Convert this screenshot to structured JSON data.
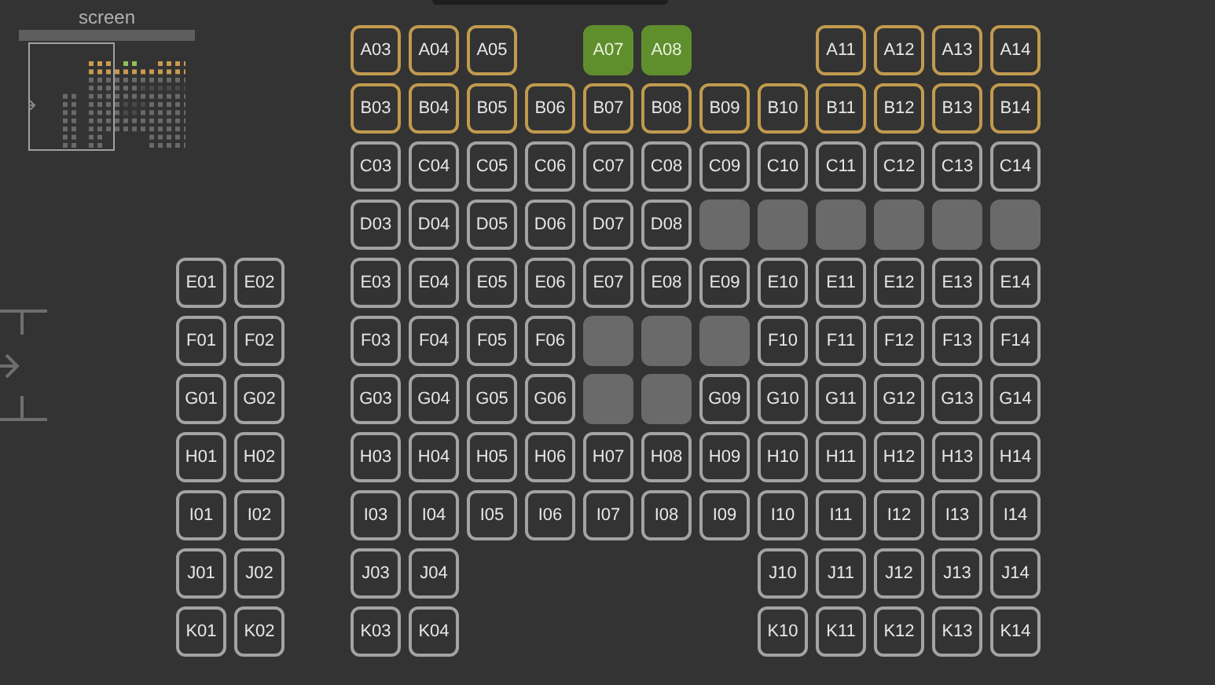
{
  "minimap": {
    "title": "screen"
  },
  "rows": [
    {
      "seats": [
        {
          "kind": "none"
        },
        {
          "kind": "none"
        },
        {
          "kind": "premium",
          "label": "A03"
        },
        {
          "kind": "premium",
          "label": "A04"
        },
        {
          "kind": "premium",
          "label": "A05"
        },
        {
          "kind": "none"
        },
        {
          "kind": "selected",
          "label": "A07"
        },
        {
          "kind": "selected",
          "label": "A08"
        },
        {
          "kind": "none"
        },
        {
          "kind": "none"
        },
        {
          "kind": "premium",
          "label": "A11"
        },
        {
          "kind": "premium",
          "label": "A12"
        },
        {
          "kind": "premium",
          "label": "A13"
        },
        {
          "kind": "premium",
          "label": "A14"
        }
      ]
    },
    {
      "seats": [
        {
          "kind": "none"
        },
        {
          "kind": "none"
        },
        {
          "kind": "premium",
          "label": "B03"
        },
        {
          "kind": "premium",
          "label": "B04"
        },
        {
          "kind": "premium",
          "label": "B05"
        },
        {
          "kind": "premium",
          "label": "B06"
        },
        {
          "kind": "premium",
          "label": "B07"
        },
        {
          "kind": "premium",
          "label": "B08"
        },
        {
          "kind": "premium",
          "label": "B09"
        },
        {
          "kind": "premium",
          "label": "B10"
        },
        {
          "kind": "premium",
          "label": "B11"
        },
        {
          "kind": "premium",
          "label": "B12"
        },
        {
          "kind": "premium",
          "label": "B13"
        },
        {
          "kind": "premium",
          "label": "B14"
        }
      ]
    },
    {
      "seats": [
        {
          "kind": "none"
        },
        {
          "kind": "none"
        },
        {
          "kind": "standard",
          "label": "C03"
        },
        {
          "kind": "standard",
          "label": "C04"
        },
        {
          "kind": "standard",
          "label": "C05"
        },
        {
          "kind": "standard",
          "label": "C06"
        },
        {
          "kind": "standard",
          "label": "C07"
        },
        {
          "kind": "standard",
          "label": "C08"
        },
        {
          "kind": "standard",
          "label": "C09"
        },
        {
          "kind": "standard",
          "label": "C10"
        },
        {
          "kind": "standard",
          "label": "C11"
        },
        {
          "kind": "standard",
          "label": "C12"
        },
        {
          "kind": "standard",
          "label": "C13"
        },
        {
          "kind": "standard",
          "label": "C14"
        }
      ]
    },
    {
      "seats": [
        {
          "kind": "none"
        },
        {
          "kind": "none"
        },
        {
          "kind": "standard",
          "label": "D03"
        },
        {
          "kind": "standard",
          "label": "D04"
        },
        {
          "kind": "standard",
          "label": "D05"
        },
        {
          "kind": "standard",
          "label": "D06"
        },
        {
          "kind": "standard",
          "label": "D07"
        },
        {
          "kind": "standard",
          "label": "D08"
        },
        {
          "kind": "taken"
        },
        {
          "kind": "taken"
        },
        {
          "kind": "taken"
        },
        {
          "kind": "taken"
        },
        {
          "kind": "taken"
        },
        {
          "kind": "taken"
        }
      ]
    },
    {
      "seats": [
        {
          "kind": "standard",
          "label": "E01"
        },
        {
          "kind": "standard",
          "label": "E02"
        },
        {
          "kind": "standard",
          "label": "E03"
        },
        {
          "kind": "standard",
          "label": "E04"
        },
        {
          "kind": "standard",
          "label": "E05"
        },
        {
          "kind": "standard",
          "label": "E06"
        },
        {
          "kind": "standard",
          "label": "E07"
        },
        {
          "kind": "standard",
          "label": "E08"
        },
        {
          "kind": "standard",
          "label": "E09"
        },
        {
          "kind": "standard",
          "label": "E10"
        },
        {
          "kind": "standard",
          "label": "E11"
        },
        {
          "kind": "standard",
          "label": "E12"
        },
        {
          "kind": "standard",
          "label": "E13"
        },
        {
          "kind": "standard",
          "label": "E14"
        }
      ]
    },
    {
      "seats": [
        {
          "kind": "standard",
          "label": "F01"
        },
        {
          "kind": "standard",
          "label": "F02"
        },
        {
          "kind": "standard",
          "label": "F03"
        },
        {
          "kind": "standard",
          "label": "F04"
        },
        {
          "kind": "standard",
          "label": "F05"
        },
        {
          "kind": "standard",
          "label": "F06"
        },
        {
          "kind": "taken"
        },
        {
          "kind": "taken"
        },
        {
          "kind": "taken"
        },
        {
          "kind": "standard",
          "label": "F10"
        },
        {
          "kind": "standard",
          "label": "F11"
        },
        {
          "kind": "standard",
          "label": "F12"
        },
        {
          "kind": "standard",
          "label": "F13"
        },
        {
          "kind": "standard",
          "label": "F14"
        }
      ]
    },
    {
      "seats": [
        {
          "kind": "standard",
          "label": "G01"
        },
        {
          "kind": "standard",
          "label": "G02"
        },
        {
          "kind": "standard",
          "label": "G03"
        },
        {
          "kind": "standard",
          "label": "G04"
        },
        {
          "kind": "standard",
          "label": "G05"
        },
        {
          "kind": "standard",
          "label": "G06"
        },
        {
          "kind": "taken"
        },
        {
          "kind": "taken"
        },
        {
          "kind": "standard",
          "label": "G09"
        },
        {
          "kind": "standard",
          "label": "G10"
        },
        {
          "kind": "standard",
          "label": "G11"
        },
        {
          "kind": "standard",
          "label": "G12"
        },
        {
          "kind": "standard",
          "label": "G13"
        },
        {
          "kind": "standard",
          "label": "G14"
        }
      ]
    },
    {
      "seats": [
        {
          "kind": "standard",
          "label": "H01"
        },
        {
          "kind": "standard",
          "label": "H02"
        },
        {
          "kind": "standard",
          "label": "H03"
        },
        {
          "kind": "standard",
          "label": "H04"
        },
        {
          "kind": "standard",
          "label": "H05"
        },
        {
          "kind": "standard",
          "label": "H06"
        },
        {
          "kind": "standard",
          "label": "H07"
        },
        {
          "kind": "standard",
          "label": "H08"
        },
        {
          "kind": "standard",
          "label": "H09"
        },
        {
          "kind": "standard",
          "label": "H10"
        },
        {
          "kind": "standard",
          "label": "H11"
        },
        {
          "kind": "standard",
          "label": "H12"
        },
        {
          "kind": "standard",
          "label": "H13"
        },
        {
          "kind": "standard",
          "label": "H14"
        }
      ]
    },
    {
      "seats": [
        {
          "kind": "standard",
          "label": "I01"
        },
        {
          "kind": "standard",
          "label": "I02"
        },
        {
          "kind": "standard",
          "label": "I03"
        },
        {
          "kind": "standard",
          "label": "I04"
        },
        {
          "kind": "standard",
          "label": "I05"
        },
        {
          "kind": "standard",
          "label": "I06"
        },
        {
          "kind": "standard",
          "label": "I07"
        },
        {
          "kind": "standard",
          "label": "I08"
        },
        {
          "kind": "standard",
          "label": "I09"
        },
        {
          "kind": "standard",
          "label": "I10"
        },
        {
          "kind": "standard",
          "label": "I11"
        },
        {
          "kind": "standard",
          "label": "I12"
        },
        {
          "kind": "standard",
          "label": "I13"
        },
        {
          "kind": "standard",
          "label": "I14"
        }
      ]
    },
    {
      "seats": [
        {
          "kind": "standard",
          "label": "J01"
        },
        {
          "kind": "standard",
          "label": "J02"
        },
        {
          "kind": "standard",
          "label": "J03"
        },
        {
          "kind": "standard",
          "label": "J04"
        },
        {
          "kind": "none"
        },
        {
          "kind": "none"
        },
        {
          "kind": "none"
        },
        {
          "kind": "none"
        },
        {
          "kind": "none"
        },
        {
          "kind": "standard",
          "label": "J10"
        },
        {
          "kind": "standard",
          "label": "J11"
        },
        {
          "kind": "standard",
          "label": "J12"
        },
        {
          "kind": "standard",
          "label": "J13"
        },
        {
          "kind": "standard",
          "label": "J14"
        }
      ]
    },
    {
      "seats": [
        {
          "kind": "standard",
          "label": "K01"
        },
        {
          "kind": "standard",
          "label": "K02"
        },
        {
          "kind": "standard",
          "label": "K03"
        },
        {
          "kind": "standard",
          "label": "K04"
        },
        {
          "kind": "none"
        },
        {
          "kind": "none"
        },
        {
          "kind": "none"
        },
        {
          "kind": "none"
        },
        {
          "kind": "none"
        },
        {
          "kind": "standard",
          "label": "K10"
        },
        {
          "kind": "standard",
          "label": "K11"
        },
        {
          "kind": "standard",
          "label": "K12"
        },
        {
          "kind": "standard",
          "label": "K13"
        },
        {
          "kind": "standard",
          "label": "K14"
        }
      ]
    }
  ]
}
